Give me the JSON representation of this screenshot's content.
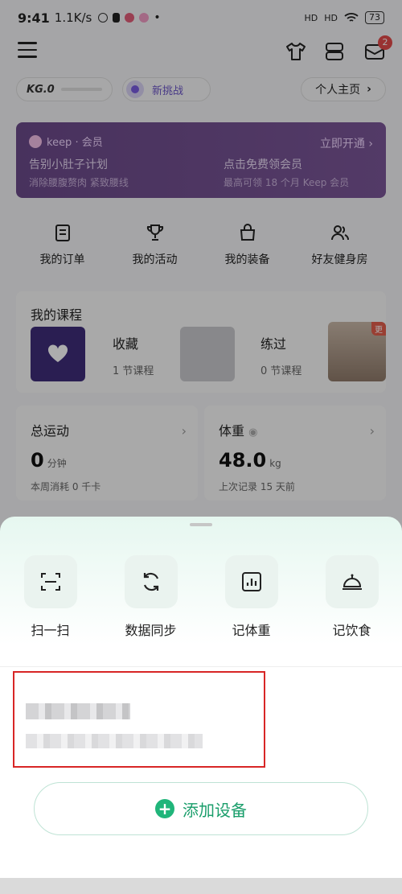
{
  "status_bar": {
    "time": "9:41",
    "speed": "1.1K/s",
    "battery": "73",
    "signal_label": "HD"
  },
  "topbar": {
    "mail_badge": "2"
  },
  "level": {
    "kg_label": "KG.0",
    "challenge_label": "新挑战",
    "profile_label": "个人主页"
  },
  "vip": {
    "brand": "keep · 会员",
    "open_label": "立即开通",
    "left_title": "告别小肚子计划",
    "left_sub": "消除腰腹赘肉 紧致腰线",
    "right_title": "点击免费领会员",
    "right_sub": "最高可领 18 个月 Keep 会员"
  },
  "quick": [
    {
      "label": "我的订单",
      "icon": "clipboard-icon"
    },
    {
      "label": "我的活动",
      "icon": "trophy-icon"
    },
    {
      "label": "我的装备",
      "icon": "bag-icon"
    },
    {
      "label": "好友健身房",
      "icon": "friends-icon"
    }
  ],
  "courses": {
    "title": "我的课程",
    "fav_label": "收藏",
    "fav_count": "1 节课程",
    "done_label": "练过",
    "done_count": "0 节课程",
    "more_tag": "更"
  },
  "stats": {
    "sport_title": "总运动",
    "sport_value": "0",
    "sport_unit": "分钟",
    "sport_note": "本周消耗 0 千卡",
    "weight_title": "体重",
    "weight_value": "48.0",
    "weight_unit": "kg",
    "weight_note": "上次记录 15 天前"
  },
  "sheet": {
    "actions": [
      {
        "label": "扫一扫",
        "icon": "scan-icon"
      },
      {
        "label": "数据同步",
        "icon": "sync-icon"
      },
      {
        "label": "记体重",
        "icon": "chart-icon"
      },
      {
        "label": "记饮食",
        "icon": "food-cover-icon"
      }
    ],
    "add_device_label": "添加设备"
  },
  "colors": {
    "accent": "#20b57a",
    "vip": "#6b4a8a",
    "highlight": "#d82626"
  }
}
